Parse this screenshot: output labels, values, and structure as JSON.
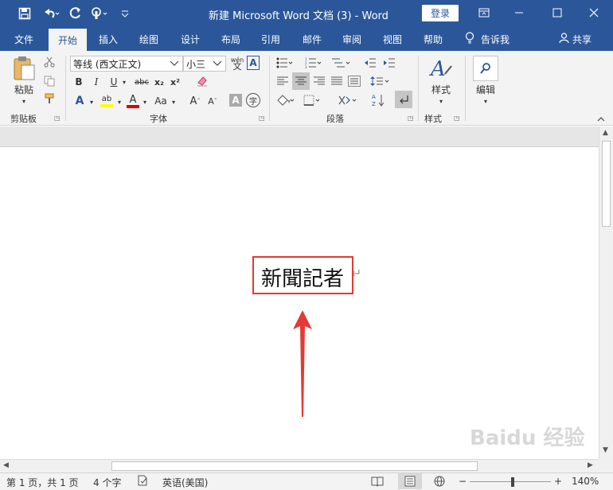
{
  "window": {
    "title": "新建 Microsoft Word 文档 (3)  -  Word",
    "login_label": "登录",
    "colors": {
      "brand": "#2b579a",
      "annotation": "#e53935"
    }
  },
  "quick_access": {
    "save_icon": "save-icon",
    "undo_icon": "undo-icon",
    "redo_icon": "redo-icon",
    "touch_icon": "touch-mode-icon",
    "customize_icon": "customize-icon"
  },
  "tabs": [
    "文件",
    "开始",
    "插入",
    "绘图",
    "设计",
    "布局",
    "引用",
    "邮件",
    "审阅",
    "视图",
    "帮助",
    "告诉我",
    "共享"
  ],
  "ribbon": {
    "clipboard": {
      "label": "剪贴板",
      "paste_label": "粘贴"
    },
    "font": {
      "label": "字体",
      "font_name": "等线 (西文正文)",
      "font_size": "小三",
      "phonetic_glyph": "wén",
      "border_glyph": "A",
      "bold": "B",
      "italic": "I",
      "underline": "U",
      "strikethrough": "abc",
      "subscript": "x₂",
      "superscript": "x²",
      "text_effects": "A",
      "highlight": "ab",
      "font_color": "A",
      "change_case": "Aa",
      "grow_font": "A",
      "shrink_font": "A",
      "char_shading": "A",
      "enclose_char": "字"
    },
    "paragraph": {
      "label": "段落"
    },
    "styles": {
      "label": "样式",
      "styles_button": "样式"
    },
    "editing": {
      "edit_button": "编辑"
    }
  },
  "document": {
    "text": "新聞記者",
    "paragraph_mark": "↵"
  },
  "statusbar": {
    "page": "第 1 页，共 1 页",
    "words": "4 个字",
    "language": "英语(美国)",
    "zoom": "140%",
    "zoom_minus": "−",
    "zoom_plus": "+"
  },
  "watermark": "Baidu 经验"
}
